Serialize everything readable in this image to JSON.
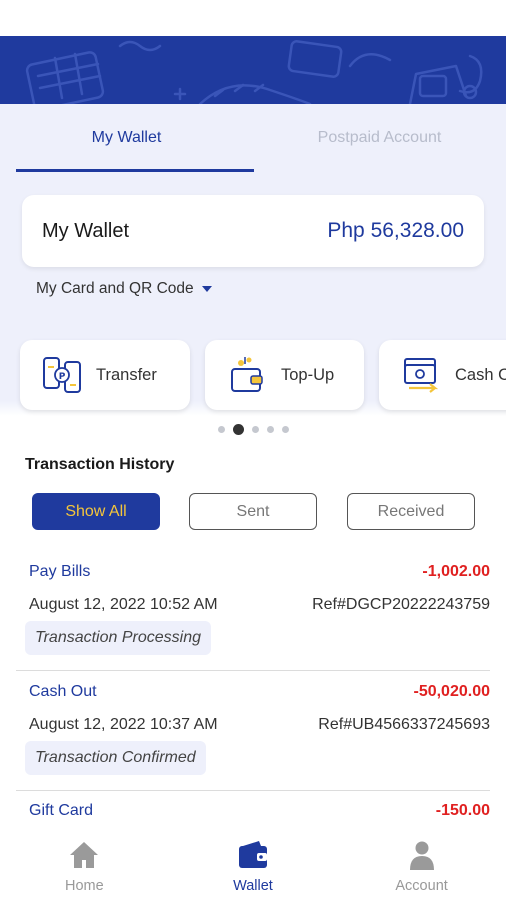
{
  "tabs": [
    {
      "label": "My Wallet",
      "active": true
    },
    {
      "label": "Postpaid Account",
      "active": false
    }
  ],
  "wallet": {
    "title": "My Wallet",
    "balance": "Php 56,328.00",
    "qr_link": "My Card and QR Code"
  },
  "actions": [
    {
      "label": "Transfer",
      "icon": "transfer-phones-icon"
    },
    {
      "label": "Top-Up",
      "icon": "wallet-topup-icon"
    },
    {
      "label": "Cash Out",
      "icon": "cash-out-icon"
    }
  ],
  "carousel": {
    "count": 5,
    "active_index": 1
  },
  "history": {
    "title": "Transaction History",
    "filters": [
      {
        "label": "Show All",
        "active": true
      },
      {
        "label": "Sent",
        "active": false
      },
      {
        "label": "Received",
        "active": false
      }
    ],
    "transactions": [
      {
        "type": "Pay Bills",
        "amount": "-1,002.00",
        "datetime": "August 12, 2022 10:52 AM",
        "ref": "Ref#DGCP20222243759",
        "status": "Transaction Processing"
      },
      {
        "type": "Cash Out",
        "amount": "-50,020.00",
        "datetime": "August 12, 2022 10:37 AM",
        "ref": "Ref#UB4566337245693",
        "status": "Transaction Confirmed"
      },
      {
        "type": "Gift Card",
        "amount": "-150.00",
        "datetime": "",
        "ref": "",
        "status": ""
      }
    ]
  },
  "bottom_nav": [
    {
      "label": "Home",
      "icon": "home-icon",
      "active": false
    },
    {
      "label": "Wallet",
      "icon": "wallet-icon",
      "active": true
    },
    {
      "label": "Account",
      "icon": "person-icon",
      "active": false
    }
  ],
  "colors": {
    "brand": "#1f3a9e",
    "accent": "#f4c53b",
    "negative": "#e02020",
    "panel": "#eef0fb"
  }
}
